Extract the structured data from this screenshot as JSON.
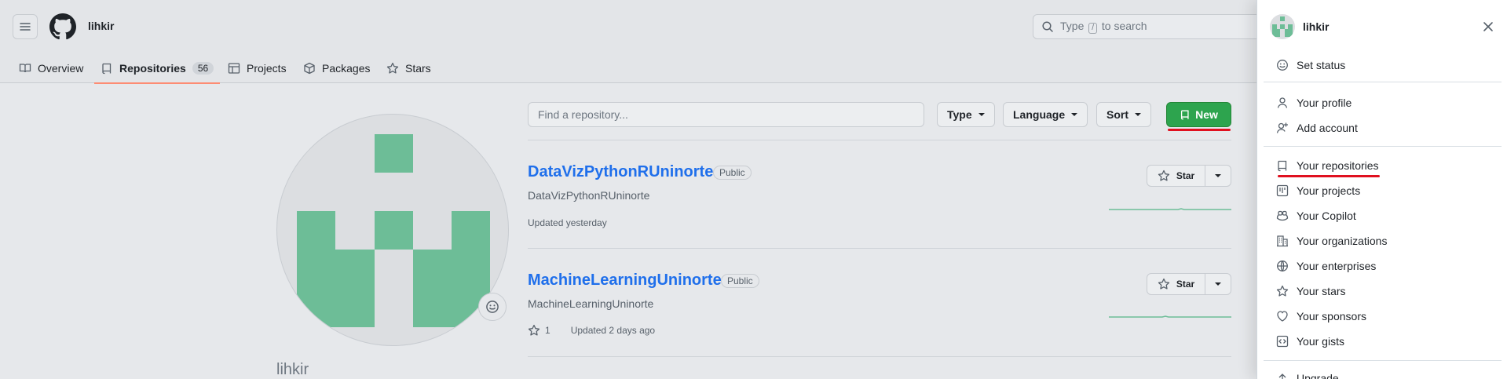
{
  "header": {
    "owner": "lihkir",
    "search_prefix": "Type",
    "search_key": "/",
    "search_suffix": "to search"
  },
  "tabs": [
    {
      "label": "Overview"
    },
    {
      "label": "Repositories",
      "count": "56"
    },
    {
      "label": "Projects"
    },
    {
      "label": "Packages"
    },
    {
      "label": "Stars"
    }
  ],
  "profile": {
    "username": "lihkir"
  },
  "filters": {
    "find_placeholder": "Find a repository...",
    "type_label": "Type",
    "language_label": "Language",
    "sort_label": "Sort",
    "new_label": "New"
  },
  "repos": [
    {
      "name": "DataVizPythonRUninorte",
      "visibility": "Public",
      "description": "DataVizPythonRUninorte",
      "updated": "Updated yesterday",
      "star_label": "Star"
    },
    {
      "name": "MachineLearningUninorte",
      "visibility": "Public",
      "description": "MachineLearningUninorte",
      "stars": "1",
      "updated": "Updated 2 days ago",
      "star_label": "Star"
    }
  ],
  "panel": {
    "username": "lihkir",
    "items": [
      {
        "label": "Set status"
      },
      {
        "label": "Your profile"
      },
      {
        "label": "Add account"
      },
      {
        "label": "Your repositories"
      },
      {
        "label": "Your projects"
      },
      {
        "label": "Your Copilot"
      },
      {
        "label": "Your organizations"
      },
      {
        "label": "Your enterprises"
      },
      {
        "label": "Your stars"
      },
      {
        "label": "Your sponsors"
      },
      {
        "label": "Your gists"
      },
      {
        "label": "Upgrade"
      }
    ]
  },
  "colors": {
    "accent_green": "#2da44e",
    "link_blue": "#1f6feb",
    "annotation_red": "#e0101f",
    "avatar_green": "#6dbd97"
  }
}
